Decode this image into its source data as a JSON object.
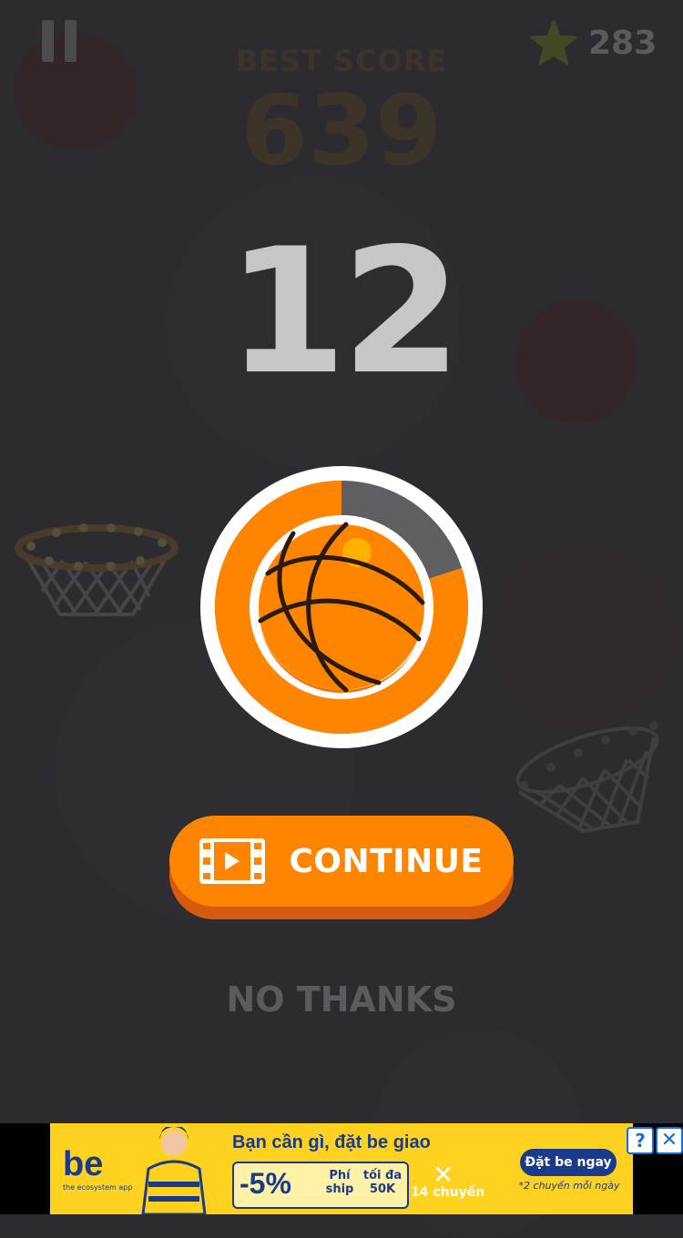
{
  "header": {
    "pause_icon": "pause-icon",
    "star_icon": "star-icon",
    "stars": "283",
    "best_score_label": "BEST SCORE",
    "best_score": "639"
  },
  "score": "12",
  "timer": {
    "remaining_fraction": 0.8
  },
  "continue_button": {
    "icon": "video-icon",
    "label": "CONTINUE"
  },
  "no_thanks": "NO THANKS",
  "ad": {
    "brand": "be",
    "brand_sub": "the ecosystem app",
    "headline": "Bạn cần gì, đặt be giao",
    "discount": "-5%",
    "phi_ship": "Phí ship",
    "toi_da": "tối đa 50K",
    "times": "✕",
    "chuyen": "14 chuyến",
    "cta": "Đặt be ngay",
    "cta_sub": "*2 chuyến mỗi ngày",
    "info": "?",
    "close": "✕"
  },
  "colors": {
    "background": "#2c2b30",
    "accent": "#ff8500",
    "ring_gray": "#5f5f63"
  }
}
